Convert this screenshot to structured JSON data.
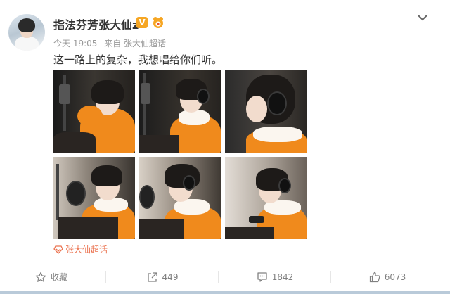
{
  "post": {
    "author": "指法芬芳张大仙z",
    "verified_badge": "V",
    "time": "今天 19:05",
    "source": "来自 张大仙超话",
    "text": "这一路上的复杂，我想唱给你们听。",
    "topic": "张大仙超话",
    "images": [
      {
        "name": "photo-1"
      },
      {
        "name": "photo-2"
      },
      {
        "name": "photo-3"
      },
      {
        "name": "photo-4"
      },
      {
        "name": "photo-5"
      },
      {
        "name": "photo-6"
      }
    ]
  },
  "actions": {
    "favorite_label": "收藏",
    "repost_count": "449",
    "comment_count": "1842",
    "like_count": "6073"
  },
  "icons": {
    "more": "chevron-down-icon",
    "favorite": "star-icon",
    "repost": "share-icon",
    "comment": "comment-icon",
    "like": "thumbs-up-icon",
    "topic": "super-topic-icon"
  },
  "colors": {
    "topic": "#eb7350",
    "verified": "#f6a623",
    "hoodie": "#f08a1c"
  }
}
